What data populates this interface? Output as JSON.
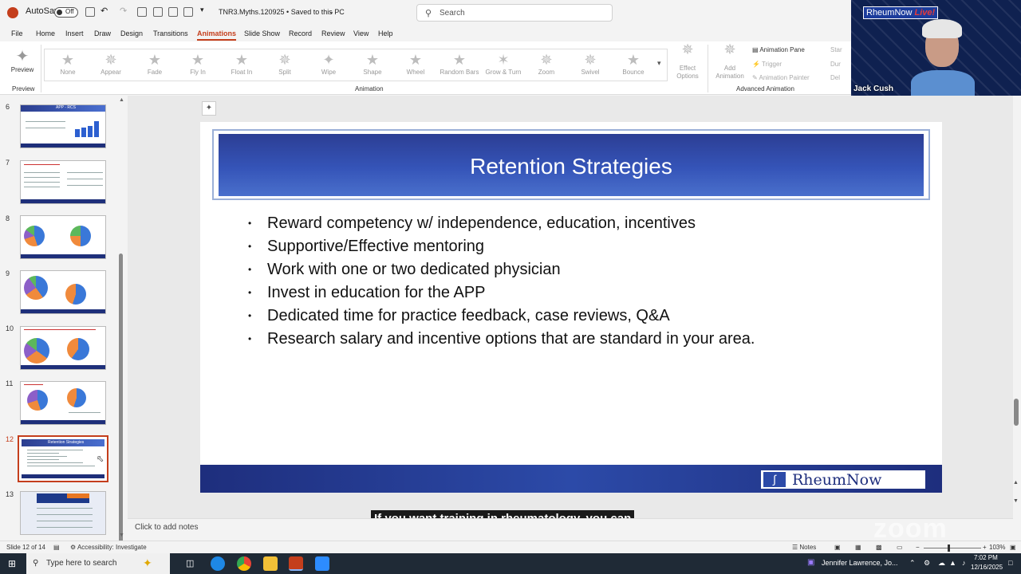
{
  "titlebar": {
    "autosave_label": "AutoSave",
    "autosave_state": "Off",
    "doc_title": "TNR3.Myths.120925 • Saved to this PC",
    "search_placeholder": "Search"
  },
  "menu": [
    "File",
    "Home",
    "Insert",
    "Draw",
    "Design",
    "Transitions",
    "Animations",
    "Slide Show",
    "Record",
    "Review",
    "View",
    "Help"
  ],
  "menu_active": "Animations",
  "ribbon": {
    "preview_label": "Preview",
    "preview_group": "Preview",
    "animation_group": "Animation",
    "advanced_group": "Advanced Animation",
    "animations": [
      "None",
      "Appear",
      "Fade",
      "Fly In",
      "Float In",
      "Split",
      "Wipe",
      "Shape",
      "Wheel",
      "Random Bars",
      "Grow & Turn",
      "Zoom",
      "Swivel",
      "Bounce"
    ],
    "effect_options": "Effect Options",
    "add_animation": "Add Animation",
    "animation_pane": "Animation Pane",
    "trigger": "Trigger",
    "animation_painter": "Animation Painter",
    "start_label": "Star",
    "duration_label": "Dur",
    "delay_label": "Del"
  },
  "thumbnails": {
    "numbers": [
      "6",
      "7",
      "8",
      "9",
      "10",
      "11",
      "12",
      "13"
    ],
    "active": "12",
    "slide6_title": "APP - RCS",
    "slide12_title": "Retention Strategies"
  },
  "slide": {
    "title": "Retention Strategies",
    "bullets": [
      "Reward competency w/ independence, education, incentives",
      "Supportive/Effective mentoring",
      "Work with one or two dedicated physician",
      "Invest in education for the APP",
      "Dedicated time for practice feedback, case reviews, Q&A",
      "Research salary and incentive options that are standard in your area."
    ],
    "footer_logo": "RheumNow"
  },
  "caption": "If you want training in rheumatology, you can",
  "notes_placeholder": "Click to add notes",
  "statusbar": {
    "slide_info": "Slide 12 of 14",
    "accessibility": "Accessibility: Investigate",
    "notes": "Notes",
    "zoom": "103%"
  },
  "taskbar": {
    "search_placeholder": "Type here to search",
    "meeting_label": "Jennifer Lawrence, Jo...",
    "time": "7:02 PM",
    "date": "12/16/2025"
  },
  "video": {
    "brand": "RheumNow",
    "brand_live": "Live!",
    "name": "Jack Cush"
  },
  "watermark": "zoom",
  "colors": {
    "accent": "#c43e1c",
    "title_band": "#2c3e94",
    "footer_band": "#1e2e7d"
  }
}
